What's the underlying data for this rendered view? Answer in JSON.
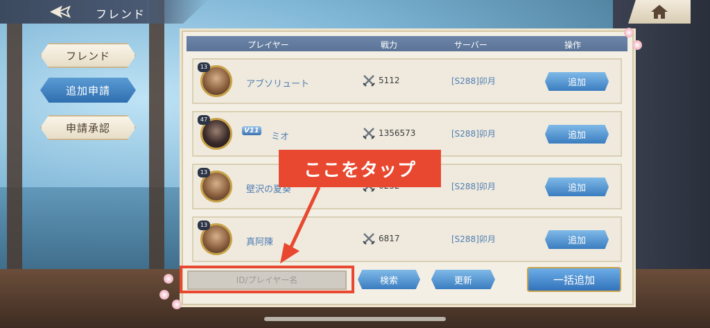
{
  "header": {
    "title": "フレンド"
  },
  "sidebar": {
    "items": [
      {
        "label": "フレンド"
      },
      {
        "label": "追加申請"
      },
      {
        "label": "申請承認"
      }
    ]
  },
  "table": {
    "columns": [
      "プレイヤー",
      "戦力",
      "サーバー",
      "操作"
    ],
    "rows": [
      {
        "level": "13",
        "vip": "",
        "name": "アブソリュート",
        "power": "5112",
        "server": "[S288]卯月",
        "action": "追加"
      },
      {
        "level": "47",
        "vip": "V11",
        "name": "ミオ",
        "power": "1356573",
        "server": "[S288]卯月",
        "action": "追加"
      },
      {
        "level": "13",
        "vip": "",
        "name": "壁沢の夏葵",
        "power": "6232",
        "server": "[S288]卯月",
        "action": "追加"
      },
      {
        "level": "13",
        "vip": "",
        "name": "真阿陳",
        "power": "6817",
        "server": "[S288]卯月",
        "action": "追加"
      }
    ]
  },
  "search": {
    "placeholder": "ID/プレイヤー名"
  },
  "buttons": {
    "search": "検索",
    "refresh": "更新",
    "bulk_add": "一括追加"
  },
  "annotation": {
    "text": "ここをタップ",
    "color": "#e8482f"
  }
}
